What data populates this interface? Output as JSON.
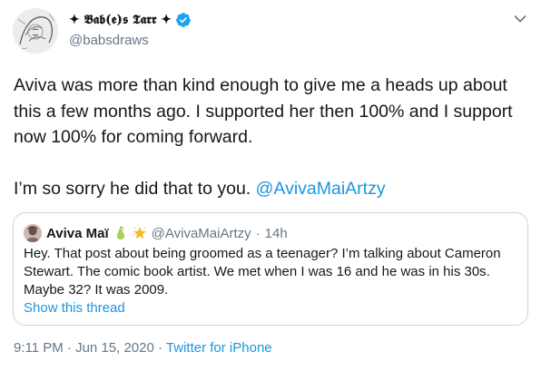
{
  "author": {
    "display_name": "✦ 𝕭𝖆𝖇(𝖊)𝖘 𝕿𝖆𝖗𝖗 ✦",
    "handle": "@babsdraws",
    "verified": true
  },
  "tweet": {
    "paragraph_1": "Aviva was more than kind enough to give me a heads up about this a few months ago.  I supported her then 100% and I support now 100% for coming forward.",
    "paragraph_2_text": "I’m so sorry he did that to you. ",
    "paragraph_2_mention": "@AvivaMaiArtzy"
  },
  "quoted_tweet": {
    "name": "Aviva Maï",
    "handle": "@AvivaMaiArtzy",
    "separator": "·",
    "time": "14h",
    "text": "Hey. That post about being groomed as a teenager? I’m talking about Cameron Stewart. The comic book artist. We met when I was 16 and he was in his 30s. Maybe 32? It was 2009.",
    "show_thread": "Show this thread"
  },
  "meta": {
    "time": "9:11 PM",
    "separator_1": "·",
    "date": "Jun 15, 2020",
    "separator_2": "·",
    "source": "Twitter for iPhone"
  },
  "colors": {
    "link": "#1b95e0",
    "muted": "#657786",
    "verified": "#1da1f2",
    "border": "#ccd6dd"
  },
  "icons": [
    "avatar-sketch",
    "verified-badge-icon",
    "chevron-down-icon",
    "pear-emoji-icon",
    "star-emoji-icon"
  ]
}
